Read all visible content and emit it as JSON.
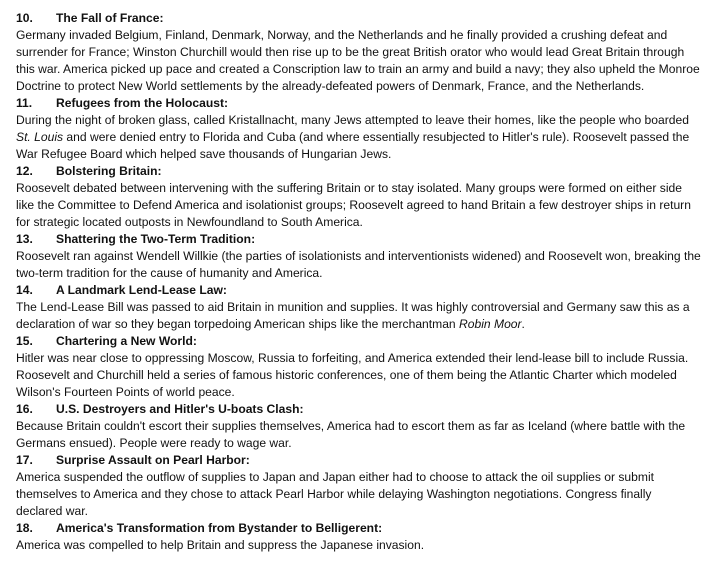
{
  "sections": [
    {
      "number": "10.",
      "title": "The Fall of France:",
      "body": "Germany invaded Belgium, Finland, Denmark, Norway, and the Netherlands and he finally provided a crushing defeat and surrender for France; Winston Churchill would then rise up to be the great British orator who would lead Great Britain through this war. America picked up pace and created a Conscription law to train an army and build a navy; they also upheld the Monroe Doctrine to protect New World settlements by the already-defeated powers of Denmark, France, and the Netherlands."
    },
    {
      "number": "11.",
      "title": "Refugees from the Holocaust:",
      "body_before": "During the night of broken glass, called Kristallnacht, many Jews attempted to leave their homes, like the people who boarded ",
      "body_italic": "St. Louis",
      "body_after": " and were denied entry to Florida and Cuba (and where essentially resubjected to Hitler's rule). Roosevelt passed the War Refugee Board which helped save thousands of Hungarian Jews."
    },
    {
      "number": "12.",
      "title": "Bolstering Britain:",
      "body": "Roosevelt debated between intervening with the suffering Britain or to stay isolated. Many groups were formed on either side like the Committee to Defend America and isolationist groups; Roosevelt agreed to hand Britain a few destroyer ships in return for strategic located outposts in Newfoundland to South America."
    },
    {
      "number": "13.",
      "title": "Shattering the Two-Term Tradition:",
      "body": "Roosevelt ran against Wendell Willkie (the parties of isolationists and interventionists widened) and Roosevelt won, breaking the two-term tradition for the cause of humanity and America."
    },
    {
      "number": "14.",
      "title": "A Landmark Lend-Lease Law:",
      "body_before": "The Lend-Lease Bill was passed to aid Britain in munition and supplies. It was highly controversial and Germany saw this as a declaration of war so they began torpedoing American ships like the merchantman ",
      "body_italic": "Robin Moor",
      "body_after": "."
    },
    {
      "number": "15.",
      "title": "Chartering a New World:",
      "body": "Hitler was near close to oppressing Moscow, Russia to forfeiting, and America extended their lend-lease bill to include Russia. Roosevelt and Churchill held a series of famous historic conferences, one of them being the Atlantic Charter which modeled Wilson's Fourteen Points of world peace."
    },
    {
      "number": "16.",
      "title": "U.S. Destroyers and Hitler's U-boats Clash:",
      "body": "Because Britain couldn't escort their supplies themselves, America had to escort them as far as Iceland (where battle with the Germans ensued). People were ready to wage war."
    },
    {
      "number": "17.",
      "title": "Surprise Assault on Pearl Harbor:",
      "body": "America suspended the outflow of supplies to Japan and Japan either had to choose to attack the oil supplies or submit themselves to America and they chose to attack Pearl Harbor while delaying Washington negotiations. Congress finally declared war."
    },
    {
      "number": "18.",
      "title": "America's Transformation from Bystander to Belligerent:",
      "body": "America was compelled to help Britain and suppress the Japanese invasion."
    }
  ]
}
